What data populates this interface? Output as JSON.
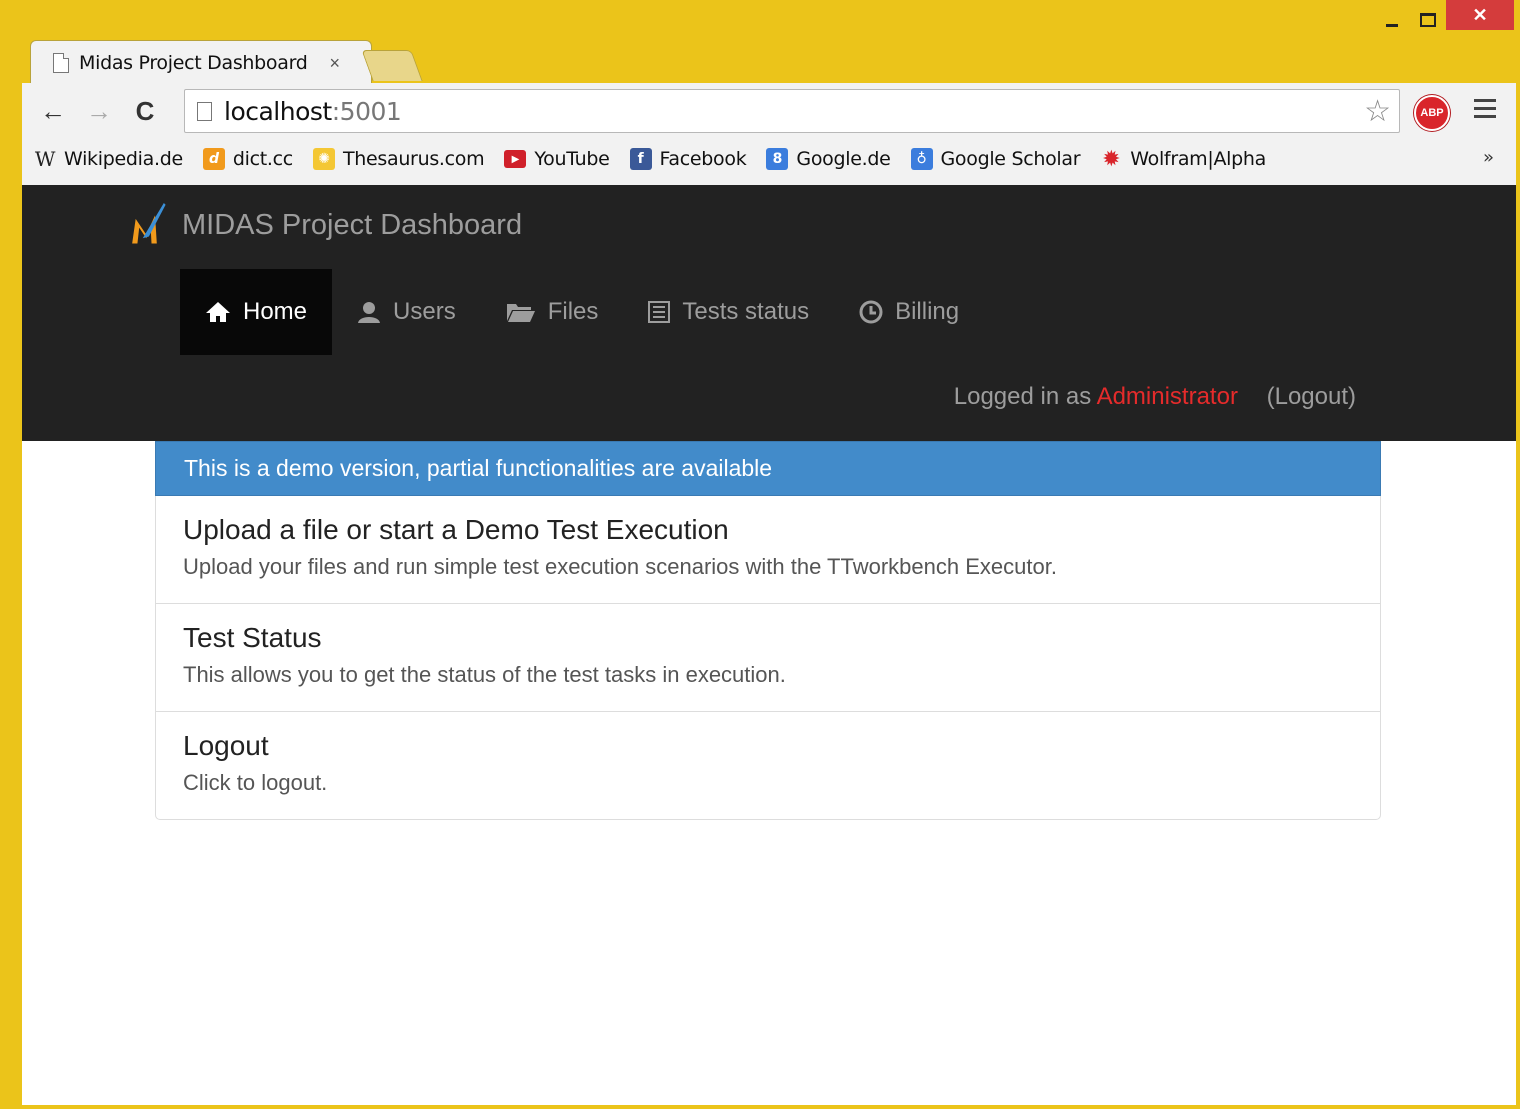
{
  "browser": {
    "tab_title": "Midas Project Dashboard",
    "tab_close": "×",
    "url_host": "localhost",
    "url_port": ":5001",
    "bookmarks": [
      {
        "label": "Wikipedia.de",
        "icon": "wikipedia-icon"
      },
      {
        "label": "dict.cc",
        "icon": "dictcc-icon"
      },
      {
        "label": "Thesaurus.com",
        "icon": "thesaurus-icon"
      },
      {
        "label": "YouTube",
        "icon": "youtube-icon"
      },
      {
        "label": "Facebook",
        "icon": "facebook-icon"
      },
      {
        "label": "Google.de",
        "icon": "google-icon"
      },
      {
        "label": "Google Scholar",
        "icon": "google-scholar-icon"
      },
      {
        "label": "Wolfram|Alpha",
        "icon": "wolframalpha-icon"
      }
    ],
    "bookmarks_more": "»",
    "abp_label": "ABP"
  },
  "navbar": {
    "brand": "MIDAS Project Dashboard",
    "items": [
      {
        "label": "Home",
        "icon": "home-icon",
        "active": true
      },
      {
        "label": "Users",
        "icon": "user-icon"
      },
      {
        "label": "Files",
        "icon": "folder-open-icon"
      },
      {
        "label": "Tests status",
        "icon": "list-icon"
      },
      {
        "label": "Billing",
        "icon": "clock-icon"
      }
    ],
    "logged_in_prefix": "Logged in as",
    "user": "Administrator",
    "logout": "(Logout)"
  },
  "main": {
    "alert": "This is a demo version, partial functionalities are available",
    "items": [
      {
        "heading": "Upload a file or start a Demo Test Execution",
        "text": "Upload your files and run simple test execution scenarios with the TTworkbench Executor."
      },
      {
        "heading": "Test Status",
        "text": "This allows you to get the status of the test tasks in execution."
      },
      {
        "heading": "Logout",
        "text": "Click to logout."
      }
    ]
  },
  "colors": {
    "window_frame": "#ebc41a",
    "navbar_bg": "#222222",
    "alert_bg": "#428bca",
    "admin_link": "#e52b2b"
  }
}
